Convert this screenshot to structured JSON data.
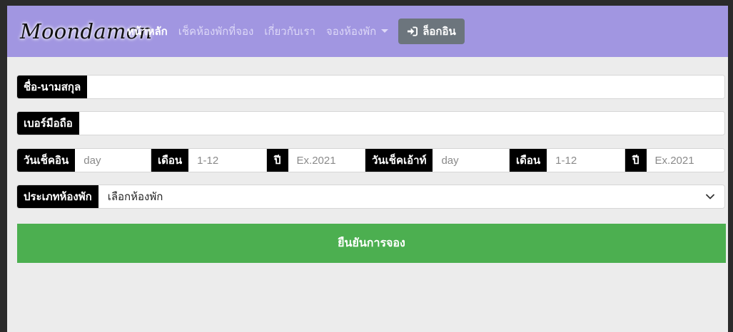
{
  "navbar": {
    "brand": "Moondamon",
    "links": [
      "หน้าหลัก",
      "เช็คห้องพักที่จอง",
      "เกี่ยวกับเรา",
      "จองห้องพัก"
    ],
    "login_label": "ล็อกอิน"
  },
  "form": {
    "fullname_label": "ชื่อ-นามสกุล",
    "fullname_value": "",
    "phone_label": "เบอร์มือถือ",
    "phone_value": "",
    "checkin_day_label": "วันเช็คอิน",
    "checkin_day_placeholder": "day",
    "checkin_month_label": "เดือน",
    "checkin_month_placeholder": "1-12",
    "checkin_year_label": "ปี",
    "checkin_year_placeholder": "Ex.2021",
    "checkout_day_label": "วันเช็คเอ้าท์",
    "checkout_day_placeholder": "day",
    "checkout_month_label": "เดือน",
    "checkout_month_placeholder": "1-12",
    "checkout_year_label": "ปี",
    "checkout_year_placeholder": "Ex.2021",
    "room_type_label": "ประเภทห้องพัก",
    "room_type_selected": "เลือกห้องพัก",
    "submit_label": "ยืนยันการจอง"
  },
  "colors": {
    "navbar_bg": "#a196e1",
    "login_button": "#6c757d",
    "submit_button": "#4caf50",
    "page_bg": "#ececec"
  },
  "icons": {
    "login": "sign-in-icon",
    "dropdown": "chevron-down-icon",
    "nav_dropdown": "caret-down-icon"
  }
}
